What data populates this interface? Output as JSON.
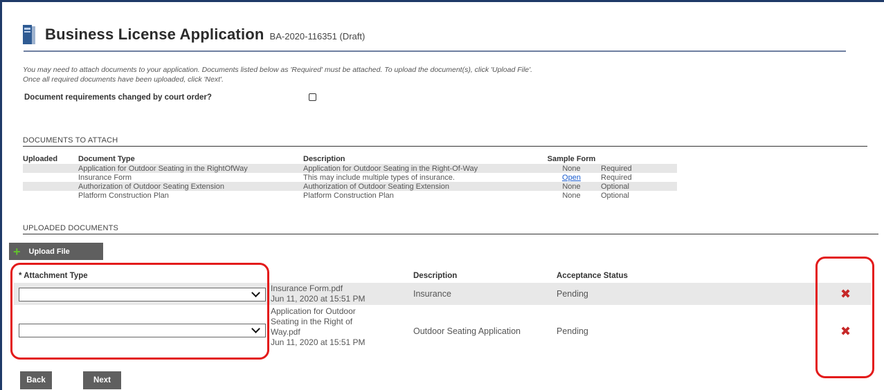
{
  "header": {
    "title": "Business License Application",
    "subtitle": "BA-2020-116351 (Draft)"
  },
  "intro": {
    "line1": "You may need to attach documents to your application. Documents listed below as 'Required' must be attached. To upload the document(s), click 'Upload File'.",
    "line2": "Once all required documents have been uploaded, click 'Next'."
  },
  "court_order": {
    "label": "Document requirements changed by court order?"
  },
  "documents_to_attach": {
    "section_label": "DOCUMENTS TO ATTACH",
    "columns": [
      "Uploaded",
      "Document Type",
      "Description",
      "Sample Form",
      ""
    ],
    "rows": [
      {
        "uploaded": "",
        "type": "Application for Outdoor Seating in the RightOfWay",
        "description": "Application for Outdoor Seating in the Right-Of-Way",
        "sample": "None",
        "requirement": "Required"
      },
      {
        "uploaded": "",
        "type": "Insurance Form",
        "description": "This may include multiple types of insurance.",
        "sample": "Open",
        "requirement": "Required"
      },
      {
        "uploaded": "",
        "type": "Authorization of Outdoor Seating Extension",
        "description": "Authorization of Outdoor Seating Extension",
        "sample": "None",
        "requirement": "Optional"
      },
      {
        "uploaded": "",
        "type": "Platform Construction Plan",
        "description": "Platform Construction Plan",
        "sample": "None",
        "requirement": "Optional"
      }
    ]
  },
  "uploaded_documents": {
    "section_label": "UPLOADED DOCUMENTS",
    "upload_button": "Upload File",
    "columns": {
      "attachment_type": "* Attachment Type",
      "description": "Description",
      "acceptance_status": "Acceptance Status"
    },
    "rows": [
      {
        "attachment_type_value": "",
        "file_lines": [
          "Insurance Form.pdf",
          "Jun 11, 2020 at 15:51 PM"
        ],
        "description": "Insurance",
        "status": "Pending"
      },
      {
        "attachment_type_value": "",
        "file_lines": [
          "Application for Outdoor",
          "Seating in the Right of",
          "Way.pdf",
          "Jun 11, 2020 at 15:51 PM"
        ],
        "description": "Outdoor Seating Application",
        "status": "Pending"
      }
    ]
  },
  "footer": {
    "back_label": "Back",
    "next_label": "Next"
  },
  "colors": {
    "frame": "#1f3a68",
    "highlight": "#e31b1b",
    "delete_icon": "#c62828",
    "button_bg": "#5f5f5f",
    "plus_icon": "#62c12e"
  },
  "icons": {
    "title": "book-icon",
    "upload": "plus-icon",
    "delete": "delete-x-icon",
    "select": "chevron-down-icon"
  }
}
